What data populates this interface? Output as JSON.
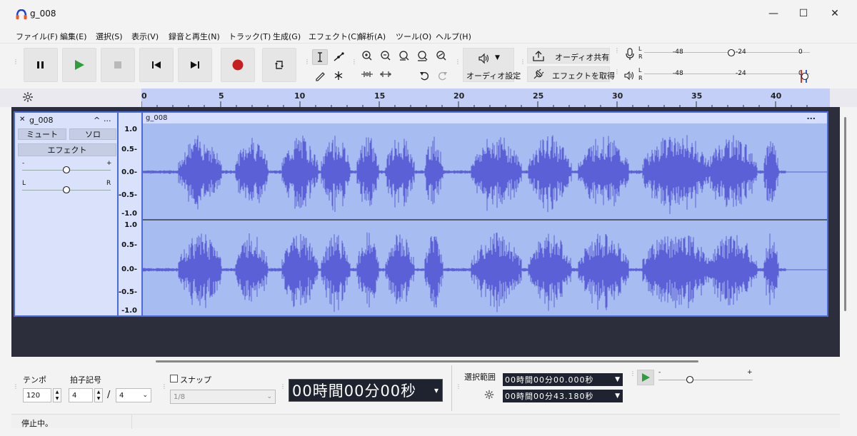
{
  "window": {
    "title": "g_008",
    "minimize": "—",
    "maximize": "☐",
    "close": "✕"
  },
  "menu": [
    "ファイル(F)",
    "編集(E)",
    "選択(S)",
    "表示(V)",
    "録音と再生(N)",
    "トラック(T)",
    "生成(G)",
    "エフェクト(C)",
    "解析(A)",
    "ツール(O)",
    "ヘルプ(H)"
  ],
  "toolbar": {
    "audio_setup_label": "オーディオ設定",
    "share_audio_label": "オーディオ共有",
    "get_effects_label": "エフェクトを取得",
    "meter_ticks": [
      "-48",
      "-24",
      "0"
    ],
    "lr": [
      "L",
      "R"
    ]
  },
  "ruler": {
    "labels": [
      "0",
      "5",
      "10",
      "15",
      "20",
      "25",
      "30",
      "35",
      "40"
    ]
  },
  "track": {
    "name": "g_008",
    "clip_name": "g_008",
    "mute": "ミュート",
    "solo": "ソロ",
    "effects": "エフェクト",
    "gain_minus": "-",
    "gain_plus": "+",
    "pan_left": "L",
    "pan_right": "R",
    "collapse": "^",
    "more": "...",
    "close": "✕",
    "scale": [
      "1.0",
      "0.5-",
      "0.0-",
      "-0.5-",
      "-1.0"
    ]
  },
  "bottom": {
    "tempo_label": "テンポ",
    "tempo_value": "120",
    "time_sig_label": "拍子記号",
    "time_sig_num": "4",
    "time_sig_slash": "/",
    "time_sig_den": "4",
    "snap_label": "スナップ",
    "snap_value": "1/8",
    "time_display": "00時間00分00秒",
    "selection_label": "選択範囲",
    "sel_start": "00時間00分00.000秒",
    "sel_end": "00時間00分43.180秒",
    "speed_minus": "-",
    "speed_plus": "+"
  },
  "status": {
    "text": "停止中。"
  }
}
